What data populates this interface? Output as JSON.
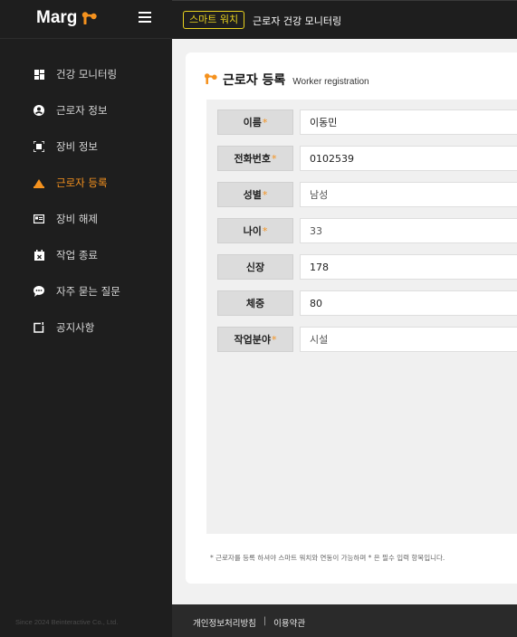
{
  "brand": {
    "name": "Marg"
  },
  "header": {
    "badge": "스마트 워치",
    "title": "근로자 건강 모니터링"
  },
  "sidebar": {
    "items": [
      {
        "label": "건강 모니터링",
        "icon": "dashboard-icon",
        "active": false
      },
      {
        "label": "근로자 정보",
        "icon": "user-circle-icon",
        "active": false
      },
      {
        "label": "장비 정보",
        "icon": "scan-icon",
        "active": false
      },
      {
        "label": "근로자 등록",
        "icon": "hardhat-icon",
        "active": true
      },
      {
        "label": "장비 해제",
        "icon": "id-card-icon",
        "active": false
      },
      {
        "label": "작업 종료",
        "icon": "calendar-x-icon",
        "active": false
      },
      {
        "label": "자주 묻는 질문",
        "icon": "chat-bubble-icon",
        "active": false
      },
      {
        "label": "공지사항",
        "icon": "notice-icon",
        "active": false
      }
    ],
    "footer": "Since 2024 Beinteractive Co., Ltd."
  },
  "main": {
    "title": "근로자 등록",
    "subtitle": "Worker registration",
    "form": [
      {
        "label": "이름",
        "required": true,
        "value": "이동민"
      },
      {
        "label": "전화번호",
        "required": true,
        "value": "0102539"
      },
      {
        "label": "성별",
        "required": true,
        "value": "남성"
      },
      {
        "label": "나이",
        "required": true,
        "value": "33"
      },
      {
        "label": "신장",
        "required": false,
        "value": "178"
      },
      {
        "label": "체중",
        "required": false,
        "value": "80"
      },
      {
        "label": "작업분야",
        "required": true,
        "value": "시설"
      }
    ],
    "note": "* 근로자를 등록 하셔야 스마트 워치와 연동이 가능하며 * 은 필수 입력 항목입니다."
  },
  "footer": {
    "privacy": "개인정보처리방침",
    "separator": "|",
    "terms": "이용약관"
  },
  "colors": {
    "accent": "#f5921e",
    "sidebar_bg": "#1e1e1e",
    "badge": "#e8d21f",
    "page_bg": "#f1f1f1"
  }
}
